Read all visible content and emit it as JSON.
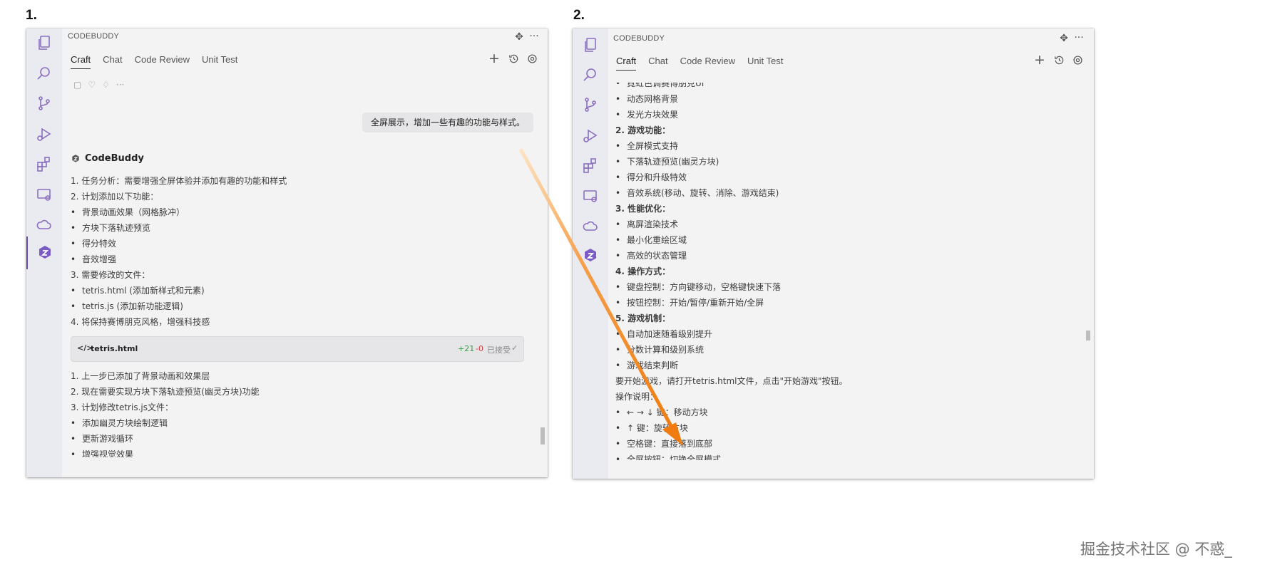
{
  "labels": {
    "step1": "1.",
    "step2": "2."
  },
  "watermark": "掘金技术社区 @ 不惑_",
  "panel1": {
    "header_title": "CODEBUDDY",
    "tabs": [
      "Craft",
      "Chat",
      "Code Review",
      "Unit Test"
    ],
    "user_message": "全屏展示，增加一些有趣的功能与样式。",
    "assistant_name": "CodeBuddy",
    "lines_a": [
      {
        "text": "1. 任务分析：需要增强全屏体验并添加有趣的功能和样式",
        "bullet": false
      },
      {
        "text": "2. 计划添加以下功能：",
        "bullet": false
      },
      {
        "text": "背景动画效果（网格脉冲）",
        "bullet": true
      },
      {
        "text": "方块下落轨迹预览",
        "bullet": true
      },
      {
        "text": "得分特效",
        "bullet": true
      },
      {
        "text": "音效增强",
        "bullet": true
      },
      {
        "text": "3. 需要修改的文件：",
        "bullet": false
      },
      {
        "text": "tetris.html (添加新样式和元素)",
        "bullet": true
      },
      {
        "text": "tetris.js (添加新功能逻辑)",
        "bullet": true
      },
      {
        "text": "4. 将保持赛博朋克风格，增强科技感",
        "bullet": false
      }
    ],
    "file_box": {
      "name": "tetris.html",
      "added": "+21",
      "removed": "-0",
      "status": "已接受"
    },
    "lines_b": [
      {
        "text": "1. 上一步已添加了背景动画和效果层",
        "bullet": false
      },
      {
        "text": "2. 现在需要实现方块下落轨迹预览(幽灵方块)功能",
        "bullet": false
      },
      {
        "text": "3. 计划修改tetris.js文件：",
        "bullet": false
      },
      {
        "text": "添加幽灵方块绘制逻辑",
        "bullet": true
      },
      {
        "text": "更新游戏循环",
        "bullet": true
      },
      {
        "text": "增强视觉效果",
        "bullet": true
      }
    ]
  },
  "panel2": {
    "header_title": "CODEBUDDY",
    "tabs": [
      "Craft",
      "Chat",
      "Code Review",
      "Unit Test"
    ],
    "lines": [
      {
        "text": "霓虹色调赛博朋克UI",
        "bullet": true,
        "bold": false
      },
      {
        "text": "动态网格背景",
        "bullet": true,
        "bold": false
      },
      {
        "text": "发光方块效果",
        "bullet": true,
        "bold": false
      },
      {
        "text": "2. 游戏功能：",
        "bullet": false,
        "bold": true
      },
      {
        "text": "全屏模式支持",
        "bullet": true,
        "bold": false
      },
      {
        "text": "下落轨迹预览(幽灵方块)",
        "bullet": true,
        "bold": false
      },
      {
        "text": "得分和升级特效",
        "bullet": true,
        "bold": false
      },
      {
        "text": "音效系统(移动、旋转、消除、游戏结束)",
        "bullet": true,
        "bold": false
      },
      {
        "text": "3. 性能优化：",
        "bullet": false,
        "bold": true
      },
      {
        "text": "离屏渲染技术",
        "bullet": true,
        "bold": false
      },
      {
        "text": "最小化重绘区域",
        "bullet": true,
        "bold": false
      },
      {
        "text": "高效的状态管理",
        "bullet": true,
        "bold": false
      },
      {
        "text": "4. 操作方式：",
        "bullet": false,
        "bold": true
      },
      {
        "text": "键盘控制：方向键移动，空格键快速下落",
        "bullet": true,
        "bold": false
      },
      {
        "text": "按钮控制：开始/暂停/重新开始/全屏",
        "bullet": true,
        "bold": false
      },
      {
        "text": "5. 游戏机制：",
        "bullet": false,
        "bold": true
      },
      {
        "text": "自动加速随着级别提升",
        "bullet": true,
        "bold": false
      },
      {
        "text": "分数计算和级别系统",
        "bullet": true,
        "bold": false
      },
      {
        "text": "游戏结束判断",
        "bullet": true,
        "bold": false
      },
      {
        "text": "要开始游戏，请打开tetris.html文件，点击\"开始游戏\"按钮。",
        "bullet": false,
        "bold": false
      },
      {
        "text": "操作说明：",
        "bullet": false,
        "bold": false
      },
      {
        "text": "← → ↓ 键：移动方块",
        "bullet": true,
        "bold": false
      },
      {
        "text": "↑ 键：旋转方块",
        "bullet": true,
        "bold": false
      },
      {
        "text": "空格键：直接落到底部",
        "bullet": true,
        "bold": false
      },
      {
        "text": "全屏按钮：切换全屏模式",
        "bullet": true,
        "bold": false
      }
    ]
  },
  "colors": {
    "arrow": "#f08a1c",
    "accent": "#6b4fa6",
    "added": "#3a9a4a",
    "removed": "#d04040"
  }
}
